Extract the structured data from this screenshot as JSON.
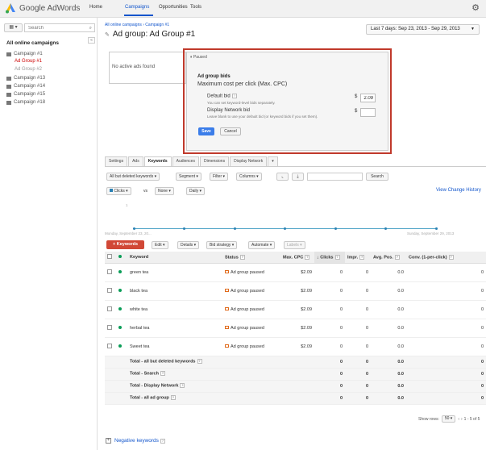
{
  "header": {
    "logo_text": "Google AdWords",
    "nav": [
      "Home",
      "Campaigns",
      "Opportunities",
      "Tools"
    ],
    "active_nav": "Campaigns"
  },
  "sidebar": {
    "search_placeholder": "Search",
    "title": "All online campaigns",
    "items": [
      {
        "label": "Campaign #1",
        "sub": [
          {
            "label": "Ad Group #1",
            "state": "active"
          },
          {
            "label": "Ad Group #2",
            "state": "muted"
          }
        ]
      },
      {
        "label": "Campaign #13"
      },
      {
        "label": "Campaign #14"
      },
      {
        "label": "Campaign #15"
      },
      {
        "label": "Campaign #18"
      }
    ]
  },
  "page": {
    "breadcrumb": "All online campaigns › Campaign #1",
    "title": "Ad group: Ad Group #1",
    "date_range": "Last 7 days: Sep 23, 2013 - Sep 29, 2013",
    "no_ads": "No active ads found"
  },
  "popup": {
    "status": "Paused",
    "title": "Ad group bids",
    "subtitle": "Maximum cost per click (Max. CPC)",
    "default_bid_label": "Default bid",
    "default_bid_hint": "You can set keyword-level bids separately.",
    "default_bid_value": "2.09",
    "display_bid_label": "Display Network bid",
    "display_bid_hint": "Leave blank to use your default bid (or keyword bids if you set them).",
    "display_bid_value": "",
    "currency": "$",
    "save": "Save",
    "cancel": "Cancel"
  },
  "tabs": [
    "Settings",
    "Ads",
    "Keywords",
    "Audiences",
    "Dimensions",
    "Display Network",
    "▾"
  ],
  "active_tab": "Keywords",
  "filters": {
    "all_but_deleted": "All but deleted keywords",
    "segment": "Segment",
    "filter": "Filter",
    "columns": "Columns",
    "search_btn": "Search"
  },
  "chart_controls": {
    "metric1": "Clicks",
    "vs": "vs",
    "metric2": "None",
    "period": "Daily",
    "view_change_history": "View Change History",
    "y_tick": "1",
    "x_start": "Monday, September 23, 20...",
    "x_end": "Sunday, September 29, 2013"
  },
  "toolbar": {
    "add_keywords": "+ Keywords",
    "edit": "Edit",
    "details": "Details",
    "bid_strategy": "Bid strategy",
    "automate": "Automate",
    "labels": "Labels"
  },
  "table": {
    "headers": {
      "keyword": "Keyword",
      "status": "Status",
      "max_cpc": "Max. CPC",
      "clicks": "Clicks",
      "impr": "Impr.",
      "avg_pos": "Avg. Pos.",
      "conv": "Conv. (1-per-click)"
    },
    "rows": [
      {
        "keyword": "green tea",
        "status": "Ad group paused",
        "max_cpc": "$2.09",
        "clicks": "0",
        "impr": "0",
        "avg_pos": "0.0",
        "conv": "0"
      },
      {
        "keyword": "black tea",
        "status": "Ad group paused",
        "max_cpc": "$2.09",
        "clicks": "0",
        "impr": "0",
        "avg_pos": "0.0",
        "conv": "0"
      },
      {
        "keyword": "white tea",
        "status": "Ad group paused",
        "max_cpc": "$2.09",
        "clicks": "0",
        "impr": "0",
        "avg_pos": "0.0",
        "conv": "0"
      },
      {
        "keyword": "herbal tea",
        "status": "Ad group paused",
        "max_cpc": "$2.09",
        "clicks": "0",
        "impr": "0",
        "avg_pos": "0.0",
        "conv": "0"
      },
      {
        "keyword": "Sweet tea",
        "status": "Ad group paused",
        "max_cpc": "$2.09",
        "clicks": "0",
        "impr": "0",
        "avg_pos": "0.0",
        "conv": "0"
      }
    ],
    "totals": [
      {
        "label": "Total - all but deleted keywords",
        "clicks": "0",
        "impr": "0",
        "avg_pos": "0.0",
        "conv": "0"
      },
      {
        "label": "Total - Search",
        "clicks": "0",
        "impr": "0",
        "avg_pos": "0.0",
        "conv": "0"
      },
      {
        "label": "Total - Display Network",
        "clicks": "0",
        "impr": "0",
        "avg_pos": "0.0",
        "conv": "0"
      },
      {
        "label": "Total - all ad group",
        "clicks": "0",
        "impr": "0",
        "avg_pos": "0.0",
        "conv": "0"
      }
    ]
  },
  "pagination": {
    "show_rows_label": "Show rows:",
    "rows_value": "50",
    "range": "1 - 5 of 5"
  },
  "negative_keywords": "Negative keywords",
  "colors": {
    "accent": "#1155cc",
    "danger": "#d14836",
    "paused": "#e06a1b",
    "save": "#3b7de9",
    "highlight": "#c0392b"
  }
}
